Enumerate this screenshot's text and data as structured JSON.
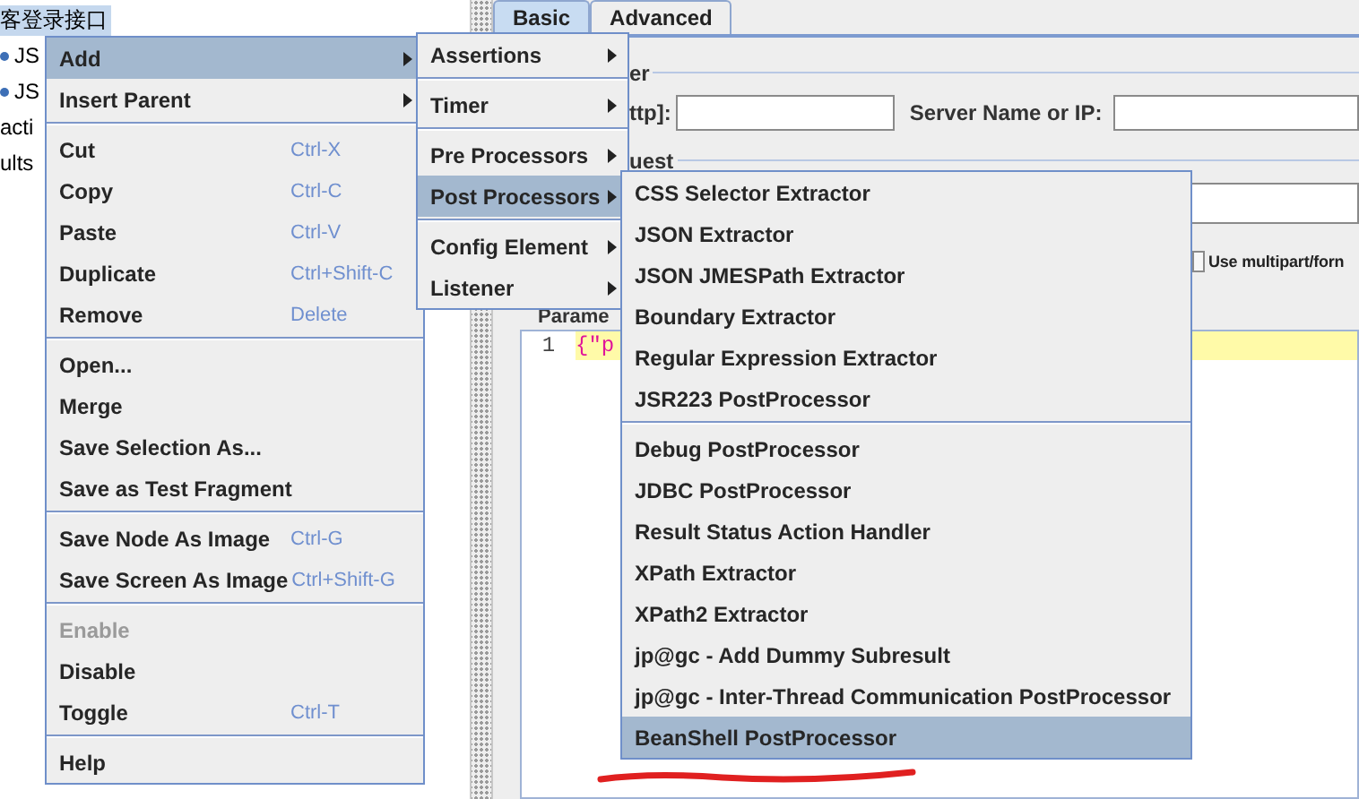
{
  "tree": {
    "items": [
      {
        "label": "客登录接口",
        "kind": "plain",
        "selected": true
      },
      {
        "label": "JS",
        "kind": "bullet",
        "selected": false
      },
      {
        "label": "JS",
        "kind": "bullet",
        "selected": false
      },
      {
        "label": "acti",
        "kind": "plain",
        "selected": false
      },
      {
        "label": "ults",
        "kind": "plain",
        "selected": false
      }
    ]
  },
  "tabs": [
    {
      "label": "Basic",
      "selected": true
    },
    {
      "label": "Advanced",
      "selected": false
    }
  ],
  "web_server": {
    "legend": "er",
    "protocol_label": "ttp]:",
    "server_label": "Server Name or IP:"
  },
  "http_request": {
    "legend": "uest",
    "multipart_label": "Use multipart/forn",
    "multipart_checked": false
  },
  "parameters_tab": "Parame",
  "editor": {
    "lines": [
      {
        "number": "1",
        "text": "{\"p"
      }
    ]
  },
  "context_menu": {
    "groups": [
      [
        {
          "label": "Add",
          "submenu": true,
          "selected": true,
          "disabled": false
        },
        {
          "label": "Insert Parent",
          "submenu": true,
          "selected": false,
          "disabled": false
        }
      ],
      [
        {
          "label": "Cut",
          "shortcut": "Ctrl-X",
          "submenu": false,
          "selected": false,
          "disabled": false
        },
        {
          "label": "Copy",
          "shortcut": "Ctrl-C",
          "submenu": false,
          "selected": false,
          "disabled": false
        },
        {
          "label": "Paste",
          "shortcut": "Ctrl-V",
          "submenu": false,
          "selected": false,
          "disabled": false
        },
        {
          "label": "Duplicate",
          "shortcut": "Ctrl+Shift-C",
          "submenu": false,
          "selected": false,
          "disabled": false
        },
        {
          "label": "Remove",
          "shortcut": "Delete",
          "submenu": false,
          "selected": false,
          "disabled": false
        }
      ],
      [
        {
          "label": "Open...",
          "submenu": false,
          "selected": false,
          "disabled": false
        },
        {
          "label": "Merge",
          "submenu": false,
          "selected": false,
          "disabled": false
        },
        {
          "label": "Save Selection As...",
          "submenu": false,
          "selected": false,
          "disabled": false
        },
        {
          "label": "Save as Test Fragment",
          "submenu": false,
          "selected": false,
          "disabled": false
        }
      ],
      [
        {
          "label": "Save Node As Image",
          "shortcut": "Ctrl-G",
          "submenu": false,
          "selected": false,
          "disabled": false
        },
        {
          "label": "Save Screen As Image",
          "shortcut": "Ctrl+Shift-G",
          "submenu": false,
          "selected": false,
          "disabled": false
        }
      ],
      [
        {
          "label": "Enable",
          "submenu": false,
          "selected": false,
          "disabled": true
        },
        {
          "label": "Disable",
          "submenu": false,
          "selected": false,
          "disabled": false
        },
        {
          "label": "Toggle",
          "shortcut": "Ctrl-T",
          "submenu": false,
          "selected": false,
          "disabled": false
        }
      ],
      [
        {
          "label": "Help",
          "submenu": false,
          "selected": false,
          "disabled": false
        }
      ]
    ]
  },
  "add_menu": {
    "groups": [
      [
        {
          "label": "Assertions",
          "submenu": true,
          "selected": false,
          "disabled": false
        }
      ],
      [
        {
          "label": "Timer",
          "submenu": true,
          "selected": false,
          "disabled": false
        }
      ],
      [
        {
          "label": "Pre Processors",
          "submenu": true,
          "selected": false,
          "disabled": false
        },
        {
          "label": "Post Processors",
          "submenu": true,
          "selected": true,
          "disabled": false
        }
      ],
      [
        {
          "label": "Config Element",
          "submenu": true,
          "selected": false,
          "disabled": false
        },
        {
          "label": "Listener",
          "submenu": true,
          "selected": false,
          "disabled": false
        }
      ]
    ]
  },
  "post_processors_menu": {
    "groups": [
      [
        {
          "label": "CSS Selector Extractor",
          "submenu": false,
          "selected": false,
          "disabled": false
        },
        {
          "label": "JSON Extractor",
          "submenu": false,
          "selected": false,
          "disabled": false
        },
        {
          "label": "JSON JMESPath Extractor",
          "submenu": false,
          "selected": false,
          "disabled": false
        },
        {
          "label": "Boundary Extractor",
          "submenu": false,
          "selected": false,
          "disabled": false
        },
        {
          "label": "Regular Expression Extractor",
          "submenu": false,
          "selected": false,
          "disabled": false
        },
        {
          "label": "JSR223 PostProcessor",
          "submenu": false,
          "selected": false,
          "disabled": false
        }
      ],
      [
        {
          "label": "Debug PostProcessor",
          "submenu": false,
          "selected": false,
          "disabled": false
        },
        {
          "label": "JDBC PostProcessor",
          "submenu": false,
          "selected": false,
          "disabled": false
        },
        {
          "label": "Result Status Action Handler",
          "submenu": false,
          "selected": false,
          "disabled": false
        },
        {
          "label": "XPath Extractor",
          "submenu": false,
          "selected": false,
          "disabled": false
        },
        {
          "label": "XPath2 Extractor",
          "submenu": false,
          "selected": false,
          "disabled": false
        },
        {
          "label": "jp@gc - Add Dummy Subresult",
          "submenu": false,
          "selected": false,
          "disabled": false
        },
        {
          "label": "jp@gc - Inter-Thread Communication PostProcessor",
          "submenu": false,
          "selected": false,
          "disabled": false
        },
        {
          "label": "BeanShell PostProcessor",
          "submenu": false,
          "selected": true,
          "disabled": false
        }
      ]
    ]
  }
}
